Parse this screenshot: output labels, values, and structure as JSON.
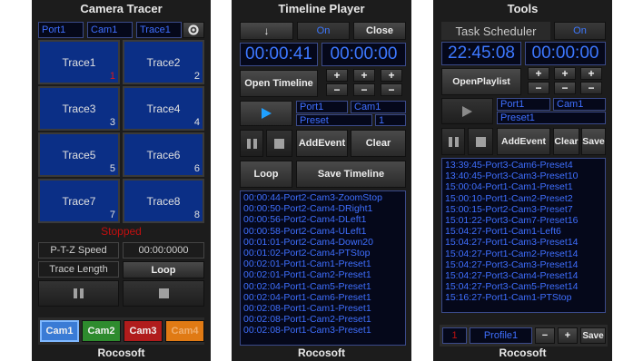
{
  "camera_tracer": {
    "title": "Camera Tracer",
    "port": "Port1",
    "cam": "Cam1",
    "trace": "Trace1",
    "traces": [
      {
        "label": "Trace1",
        "num": "1"
      },
      {
        "label": "Trace2",
        "num": "2"
      },
      {
        "label": "Trace3",
        "num": "3"
      },
      {
        "label": "Trace4",
        "num": "4"
      },
      {
        "label": "Trace5",
        "num": "5"
      },
      {
        "label": "Trace6",
        "num": "6"
      },
      {
        "label": "Trace7",
        "num": "7"
      },
      {
        "label": "Trace8",
        "num": "8"
      }
    ],
    "status": "Stopped",
    "ptz_label": "P-T-Z Speed",
    "ptz_value": "00:00:0000",
    "trace_length_label": "Trace Length",
    "loop": "Loop",
    "cams": [
      {
        "label": "Cam1",
        "color": "#3a7bd5"
      },
      {
        "label": "Cam2",
        "color": "#2e8b2e"
      },
      {
        "label": "Cam3",
        "color": "#b01c1c"
      },
      {
        "label": "Cam4",
        "color": "#e07a14"
      }
    ],
    "footer": "Rocosoft"
  },
  "timeline_player": {
    "title": "Timeline Player",
    "on": "On",
    "close": "Close",
    "clock1": "00:00:41",
    "clock2": "00:00:00",
    "open_timeline": "Open Timeline",
    "port": "Port1",
    "cam": "Cam1",
    "preset": "Preset",
    "preset_num": "1",
    "add_event": "AddEvent",
    "clear": "Clear",
    "loop": "Loop",
    "save_timeline": "Save Timeline",
    "events": [
      "00:00:44-Port2-Cam3-ZoomStop",
      "00:00:50-Port2-Cam4-DRight1",
      "00:00:56-Port2-Cam4-DLeft1",
      "00:00:58-Port2-Cam4-ULeft1",
      "00:01:01-Port2-Cam4-Down20",
      "00:01:02-Port2-Cam4-PTStop",
      "00:02:01-Port1-Cam1-Preset1",
      "00:02:01-Port1-Cam2-Preset1",
      "00:02:04-Port1-Cam5-Preset1",
      "00:02:04-Port1-Cam6-Preset1",
      "00:02:08-Port1-Cam1-Preset1",
      "00:02:08-Port1-Cam2-Preset1",
      "00:02:08-Port1-Cam3-Preset1"
    ],
    "footer": "Rocosoft"
  },
  "tools": {
    "title": "Tools",
    "scheduler_label": "Task Scheduler",
    "on": "On",
    "clock1": "22:45:08",
    "clock2": "00:00:00",
    "open_playlist": "OpenPlaylist",
    "port": "Port1",
    "cam": "Cam1",
    "preset": "Preset1",
    "add_event": "AddEvent",
    "clear": "Clear",
    "save": "Save",
    "tasks": [
      "13:39:45-Port3-Cam6-Preset4",
      "13:40:45-Port3-Cam3-Preset10",
      "15:00:04-Port1-Cam1-Preset1",
      "15:00:10-Port1-Cam2-Preset2",
      "15:00:15-Port2-Cam3-Preset7",
      "15:01:22-Port3-Cam7-Preset16",
      "15:04:27-Port1-Cam1-Left6",
      "15:04:27-Port1-Cam3-Preset14",
      "15:04:27-Port1-Cam2-Preset14",
      "15:04:27-Port3-Cam3-Preset14",
      "15:04:27-Port3-Cam4-Preset14",
      "15:04:27-Port3-Cam5-Preset14",
      "15:16:27-Port1-Cam1-PTStop"
    ],
    "profile_num": "1",
    "profile": "Profile1",
    "minus": "−",
    "plus": "+",
    "footer": "Rocosoft"
  }
}
